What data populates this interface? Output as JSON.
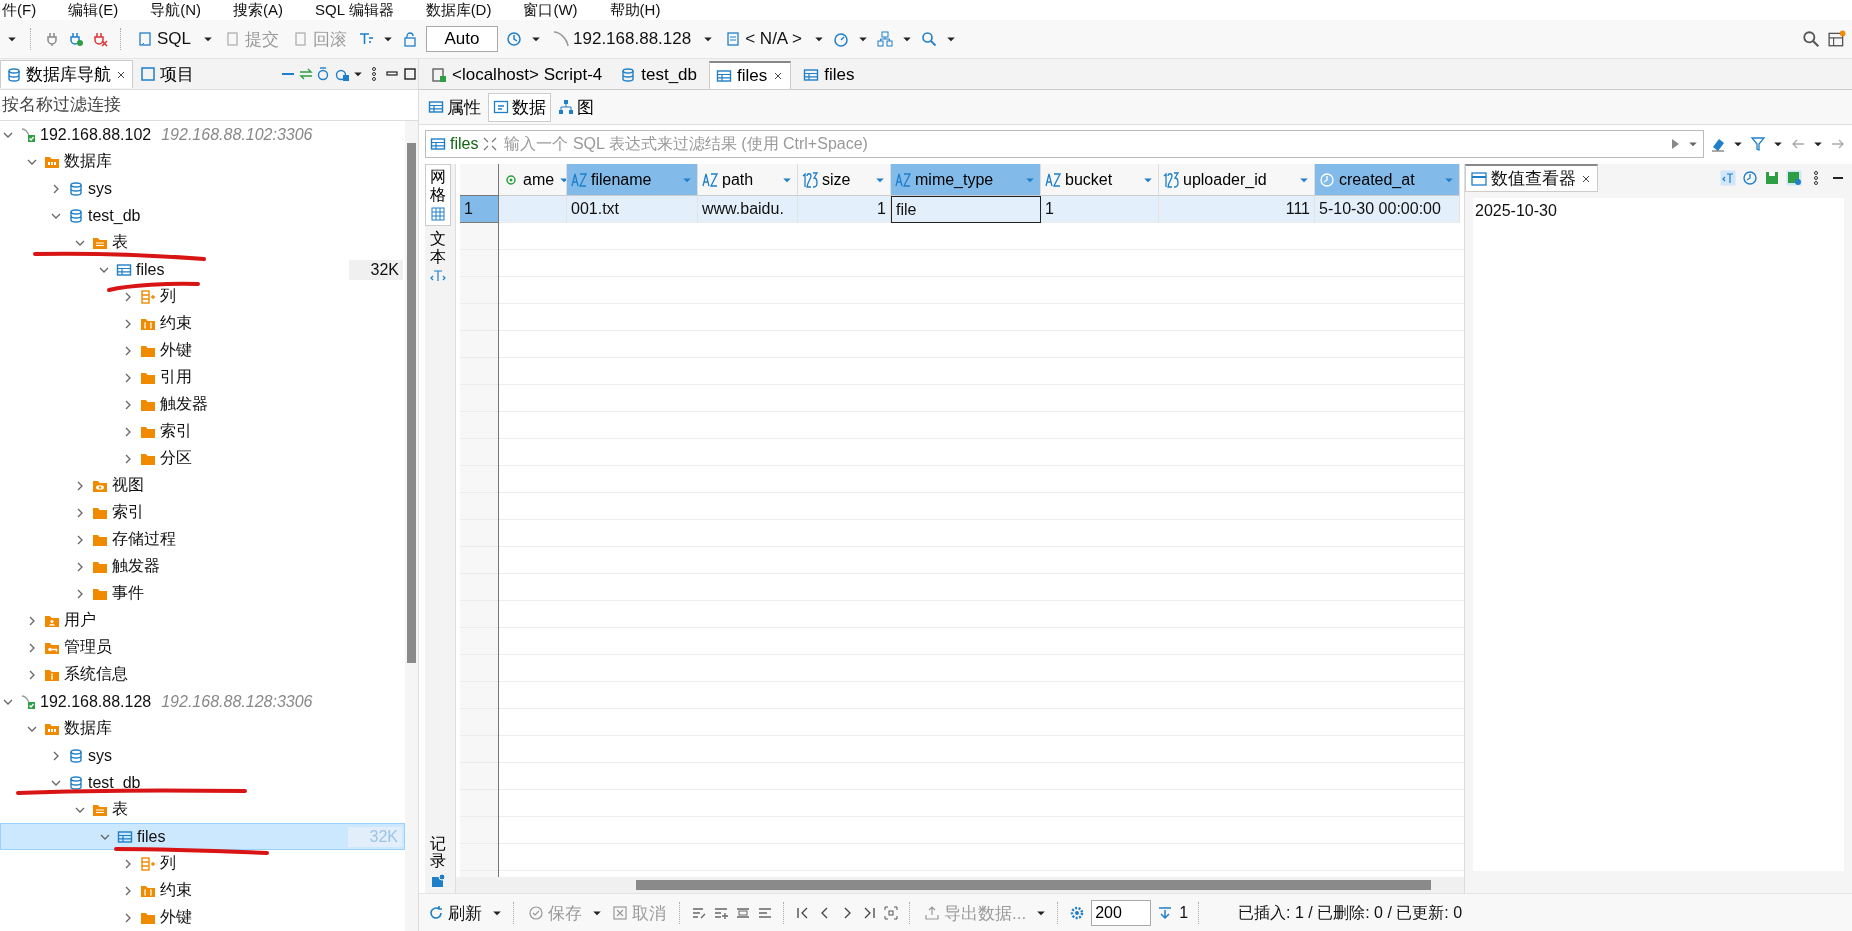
{
  "menu": [
    "件(F)",
    "编辑(E)",
    "导航(N)",
    "搜索(A)",
    "SQL 编辑器",
    "数据库(D)",
    "窗口(W)",
    "帮助(H)"
  ],
  "toolbar": {
    "sql": "SQL",
    "commit": {
      "label": "提交",
      "disabled": true
    },
    "rollback": {
      "label": "回滚",
      "disabled": true
    },
    "mode": "Auto",
    "connection": "192.168.88.128",
    "schema": "< N/A >"
  },
  "navigator": {
    "tabs": [
      {
        "label": "数据库导航",
        "selected": true,
        "closable": true
      },
      {
        "label": "项目",
        "selected": false,
        "closable": false
      }
    ],
    "filter_placeholder": "按名称过滤连接",
    "tree": [
      {
        "label": "192.168.88.102",
        "detail": "192.168.88.102:3306",
        "kind": "connection",
        "expanded": true,
        "selected": false,
        "children": [
          {
            "label": "数据库",
            "kind": "dbfolder",
            "expanded": true,
            "selected": false,
            "children": [
              {
                "label": "sys",
                "kind": "database",
                "expanded": false,
                "selected": false
              },
              {
                "label": "test_db",
                "kind": "database",
                "expanded": true,
                "selected": false,
                "children": [
                  {
                    "label": "表",
                    "kind": "tablefolder",
                    "expanded": true,
                    "selected": false,
                    "children": [
                      {
                        "label": "files",
                        "kind": "table",
                        "expanded": true,
                        "selected": false,
                        "size": "32K",
                        "children": [
                          {
                            "label": "列",
                            "kind": "columns",
                            "expanded": false,
                            "selected": false
                          },
                          {
                            "label": "约束",
                            "kind": "constraints",
                            "expanded": false,
                            "selected": false
                          },
                          {
                            "label": "外键",
                            "kind": "folder",
                            "expanded": false,
                            "selected": false
                          },
                          {
                            "label": "引用",
                            "kind": "folder",
                            "expanded": false,
                            "selected": false
                          },
                          {
                            "label": "触发器",
                            "kind": "folder",
                            "expanded": false,
                            "selected": false
                          },
                          {
                            "label": "索引",
                            "kind": "folder",
                            "expanded": false,
                            "selected": false
                          },
                          {
                            "label": "分区",
                            "kind": "folder",
                            "expanded": false,
                            "selected": false
                          }
                        ]
                      }
                    ]
                  },
                  {
                    "label": "视图",
                    "kind": "view",
                    "expanded": false,
                    "selected": false
                  },
                  {
                    "label": "索引",
                    "kind": "folder",
                    "expanded": false,
                    "selected": false
                  },
                  {
                    "label": "存储过程",
                    "kind": "folder",
                    "expanded": false,
                    "selected": false
                  },
                  {
                    "label": "触发器",
                    "kind": "folder",
                    "expanded": false,
                    "selected": false
                  },
                  {
                    "label": "事件",
                    "kind": "folder",
                    "expanded": false,
                    "selected": false
                  }
                ]
              }
            ]
          },
          {
            "label": "用户",
            "kind": "users",
            "expanded": false,
            "selected": false
          },
          {
            "label": "管理员",
            "kind": "admin",
            "expanded": false,
            "selected": false
          },
          {
            "label": "系统信息",
            "kind": "info",
            "expanded": false,
            "selected": false
          }
        ]
      },
      {
        "label": "192.168.88.128",
        "detail": "192.168.88.128:3306",
        "kind": "connection",
        "expanded": true,
        "selected": false,
        "children": [
          {
            "label": "数据库",
            "kind": "dbfolder",
            "expanded": true,
            "selected": false,
            "children": [
              {
                "label": "sys",
                "kind": "database",
                "expanded": false,
                "selected": false
              },
              {
                "label": "test_db",
                "kind": "database",
                "expanded": true,
                "selected": false,
                "children": [
                  {
                    "label": "表",
                    "kind": "tablefolder",
                    "expanded": true,
                    "selected": false,
                    "children": [
                      {
                        "label": "files",
                        "kind": "table",
                        "expanded": true,
                        "selected": true,
                        "size": "32K",
                        "children": [
                          {
                            "label": "列",
                            "kind": "columns",
                            "expanded": false,
                            "selected": false
                          },
                          {
                            "label": "约束",
                            "kind": "constraints",
                            "expanded": false,
                            "selected": false
                          },
                          {
                            "label": "外键",
                            "kind": "folder",
                            "expanded": false,
                            "selected": false
                          }
                        ]
                      }
                    ]
                  }
                ]
              }
            ]
          }
        ]
      }
    ]
  },
  "editor": {
    "tabs": [
      {
        "label": "<localhost> Script-4",
        "kind": "script",
        "selected": false,
        "closable": false
      },
      {
        "label": "test_db",
        "kind": "database",
        "selected": false,
        "closable": false
      },
      {
        "label": "files",
        "kind": "table",
        "selected": true,
        "closable": true
      },
      {
        "label": "files",
        "kind": "table",
        "selected": false,
        "closable": false
      }
    ],
    "subtabs": [
      {
        "label": "属性",
        "kind": "properties",
        "selected": false
      },
      {
        "label": "数据",
        "kind": "data",
        "selected": true
      },
      {
        "label": "图",
        "kind": "diagram",
        "selected": false
      }
    ],
    "filter": {
      "table": "files",
      "placeholder": "输入一个 SQL 表达式来过滤结果 (使用 Ctrl+Space)"
    },
    "view_tabs": [
      {
        "label": "网格",
        "selected": true
      },
      {
        "label": "文本",
        "selected": false
      },
      {
        "label": "记录",
        "selected": false
      }
    ],
    "grid": {
      "columns": [
        {
          "name": "ame",
          "kind": "other",
          "selected": false
        },
        {
          "name": "filename",
          "kind": "text",
          "selected": true
        },
        {
          "name": "path",
          "kind": "text",
          "selected": false
        },
        {
          "name": "size",
          "kind": "number",
          "selected": false
        },
        {
          "name": "mime_type",
          "kind": "text",
          "selected": true
        },
        {
          "name": "bucket",
          "kind": "text",
          "selected": false
        },
        {
          "name": "uploader_id",
          "kind": "number",
          "selected": false
        },
        {
          "name": "created_at",
          "kind": "datetime",
          "selected": true
        }
      ],
      "rows": [
        {
          "number": "1",
          "selected": true,
          "cells": [
            {
              "focused": false
            },
            {
              "text": "001.txt",
              "focused": false
            },
            {
              "text": "www.baidu.",
              "focused": false
            },
            {
              "text": "1",
              "focused": false
            },
            {
              "text": "file",
              "focused": true
            },
            {
              "text": "1",
              "focused": false
            },
            {
              "text": "111",
              "focused": false
            },
            {
              "text": "5-10-30 00:00:00",
              "focused": false
            }
          ]
        }
      ]
    },
    "value_viewer": {
      "title": "数值查看器",
      "value": "2025-10-30"
    },
    "bottom": {
      "refresh": "刷新",
      "save": {
        "label": "保存",
        "disabled": true
      },
      "cancel": {
        "label": "取消",
        "disabled": true
      },
      "export": {
        "label": "导出数据...",
        "disabled": true
      },
      "fetch_size": "200",
      "row_count": "1",
      "status": "已插入: 1 / 已删除: 0 / 已更新: 0"
    }
  }
}
